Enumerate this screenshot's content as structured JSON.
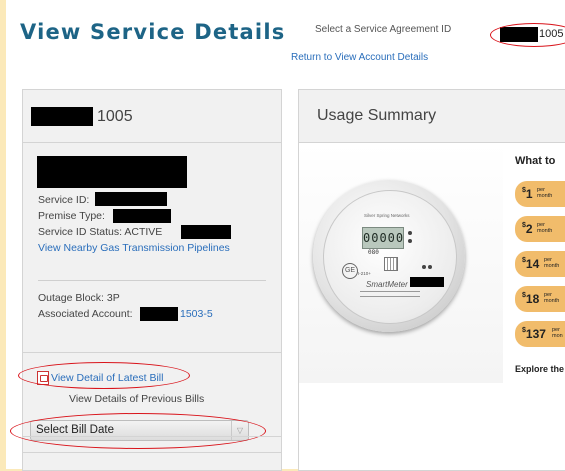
{
  "header": {
    "title": "View Service Details",
    "sa_label": "Select a Service Agreement ID",
    "sa_value_suffix": "1005",
    "return_link": "Return to View Account Details"
  },
  "account_panel": {
    "id_suffix": "1005",
    "service_id_label": "Service ID:",
    "premise_type_label": "Premise Type:",
    "status_label": "Service ID Status: ACTIVE",
    "pipelines_link": "View Nearby Gas Transmission Pipelines",
    "outage_block": "Outage Block: 3P",
    "associated_label": "Associated Account:",
    "associated_suffix": "1503-5",
    "latest_bill_link": "View Detail of Latest Bill",
    "previous_bills_label": "View Details of Previous Bills",
    "bill_date_select": "Select Bill Date"
  },
  "usage_panel": {
    "title": "Usage Summary",
    "meter_display": "00000",
    "meter_small": "080",
    "meter_brand": "SmartMeter",
    "meter_model": "I-210+",
    "meter_top_text": "Silver Spring Networks",
    "prices_heading": "What to",
    "prices": [
      {
        "amount": "1",
        "unit_top": "per",
        "unit_bottom": "month"
      },
      {
        "amount": "2",
        "unit_top": "per",
        "unit_bottom": "month"
      },
      {
        "amount": "14",
        "unit_top": "per",
        "unit_bottom": "month"
      },
      {
        "amount": "18",
        "unit_top": "per",
        "unit_bottom": "month"
      },
      {
        "amount": "137",
        "unit_top": "per",
        "unit_bottom": "mon"
      }
    ],
    "currency": "$",
    "explore": "Explore the"
  },
  "colors": {
    "title_blue": "#1d6486",
    "link_blue": "#2a6ebb",
    "annotation_red": "#d9141b",
    "price_pill": "#f1bc6b",
    "page_border": "#fbe9b9"
  }
}
